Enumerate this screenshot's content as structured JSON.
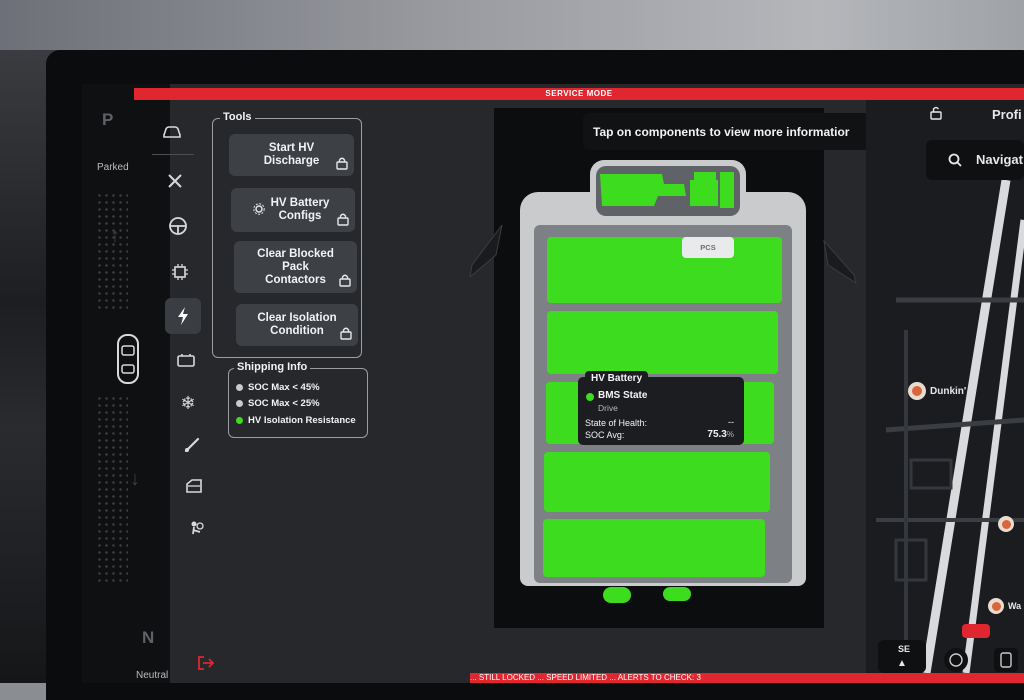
{
  "service_mode_label": "SERVICE MODE",
  "bottom_alert": "... STILL LOCKED ... SPEED LIMITED ... ALERTS TO CHECK: 3",
  "gear": {
    "p": "P",
    "parked": "Parked",
    "n": "N",
    "neutral": "Neutral"
  },
  "tools": {
    "title": "Tools",
    "buttons": [
      {
        "label": "Start HV Discharge"
      },
      {
        "label": "HV Battery Configs"
      },
      {
        "label": "Clear Blocked Pack Contactors"
      },
      {
        "label": "Clear Isolation Condition"
      }
    ]
  },
  "shipping": {
    "title": "Shipping Info",
    "items": [
      {
        "label": "SOC Max < 45%",
        "color": "#c8cacd"
      },
      {
        "label": "SOC Max < 25%",
        "color": "#c8cacd"
      },
      {
        "label": "HV Isolation Resistance",
        "color": "#3ddc1e"
      }
    ]
  },
  "banner": {
    "text": "Tap on components to view more informatior",
    "info": "i"
  },
  "pcs_label": "PCS",
  "popup": {
    "title": "HV Battery",
    "bms_label": "BMS State",
    "bms_value": "Drive",
    "soh_label": "State of Health:",
    "soh_value": "--",
    "soc_label": "SOC Avg:",
    "soc_value": "75.3",
    "soc_unit": "%"
  },
  "map": {
    "search": "Navigat",
    "profile": "Profi",
    "poi1": "Dunkin'",
    "poi2": "Wa",
    "compass": "SE"
  },
  "colors": {
    "accent_red": "#e0262f",
    "battery_green": "#3ddc1e",
    "info_blue": "#3b82f6"
  }
}
